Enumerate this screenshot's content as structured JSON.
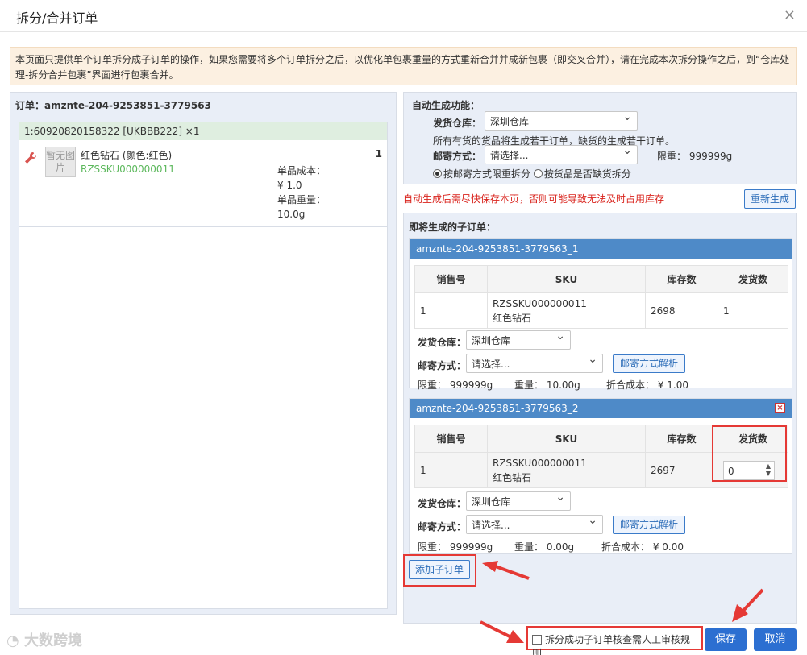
{
  "dialog": {
    "title": "拆分/合并订单",
    "close": "×"
  },
  "notice": "本页面只提供单个订单拆分成子订单的操作，如果您需要将多个订单拆分之后，以优化单包裹重量的方式重新合并并成新包裹（即交叉合并），请在完成本次拆分操作之后，到“仓库处理-拆分合并包裹”界面进行包裹合并。",
  "order": {
    "label": "订单：amznte-204-9253851-3779563",
    "package_head": "1:60920820158322  [UKBBB222] ×1",
    "item": {
      "noimg": "暂无图片",
      "name": "红色钻石 (颜色:红色)",
      "sku": "RZSSKU000000011",
      "qty": "1",
      "cost_label": "单品成本：",
      "cost": "¥ 1.0",
      "weight_label": "单品重量：",
      "weight": "10.0g"
    }
  },
  "auto": {
    "title": "自动生成功能：",
    "warehouse_label": "发货仓库：",
    "warehouse_value": "深圳仓库",
    "desc": "所有有货的货品将生成若干订单，缺货的生成若干订单。",
    "shipping_label": "邮寄方式：",
    "shipping_value": "请选择...",
    "limit": "限重：  999999g",
    "radio1": "按邮寄方式限重拆分",
    "radio2": "按货品是否缺货拆分",
    "warn": "自动生成后需尽快保存本页，否则可能导致无法及时占用库存",
    "regen_btn": "重新生成"
  },
  "suborders_title": "即将生成的子订单：",
  "suborders": [
    {
      "id": "amznte-204-9253851-3779563_1",
      "headers": [
        "销售号",
        "SKU",
        "库存数",
        "发货数"
      ],
      "row": {
        "sale": "1",
        "sku": "RZSSKU000000011",
        "name": "红色钻石",
        "stock": "2698",
        "ship": "1"
      },
      "warehouse_label": "发货仓库：",
      "warehouse_value": "深圳仓库",
      "shipping_label": "邮寄方式：",
      "shipping_value": "请选择...",
      "parse_btn": "邮寄方式解析",
      "limit": "限重：  999999g",
      "weight": "重量：  10.00g",
      "cost": "折合成本：  ¥ 1.00"
    },
    {
      "id": "amznte-204-9253851-3779563_2",
      "close": "×",
      "headers": [
        "销售号",
        "SKU",
        "库存数",
        "发货数"
      ],
      "row": {
        "sale": "1",
        "sku": "RZSSKU000000011",
        "name": "红色钻石",
        "stock": "2697",
        "ship": "0"
      },
      "warehouse_label": "发货仓库：",
      "warehouse_value": "深圳仓库",
      "shipping_label": "邮寄方式：",
      "shipping_value": "请选择...",
      "parse_btn": "邮寄方式解析",
      "limit": "限重：  999999g",
      "weight": "重量：  0.00g",
      "cost": "折合成本：  ¥ 0.00"
    }
  ],
  "add_sub_btn": "添加子订单",
  "footer": {
    "checkbox_label": "拆分成功子订单核查需人工审核规则",
    "save": "保存",
    "cancel": "取消",
    "watermark": "大数跨境"
  },
  "colors": {
    "accent": "#2c6fd1",
    "header_blue": "#4e8ac8",
    "highlight": "#e53935"
  }
}
